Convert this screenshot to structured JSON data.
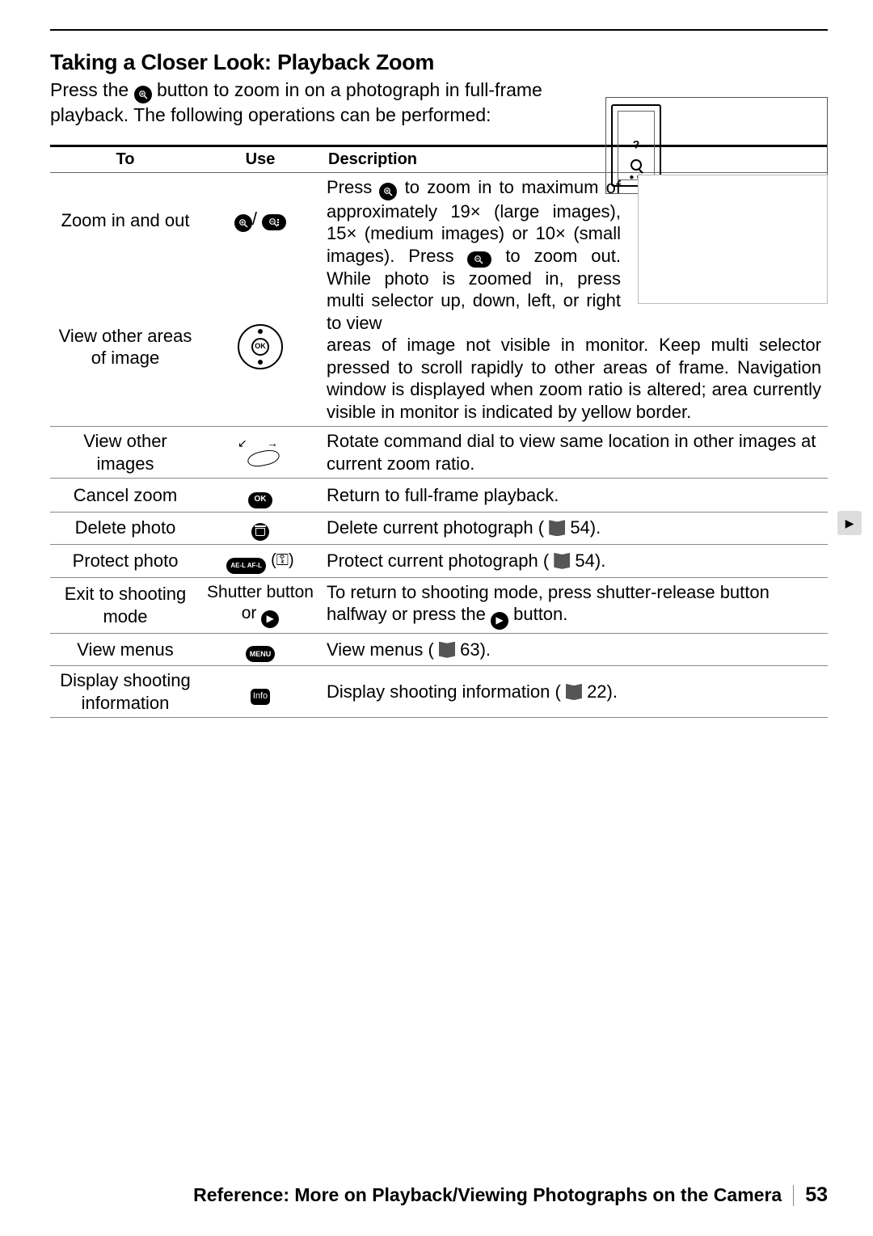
{
  "heading": "Taking a Closer Look: Playback Zoom",
  "intro_a": "Press the ",
  "intro_b": " button to zoom in on a photograph in full-frame playback.  The following operations can be performed:",
  "table": {
    "headers": {
      "to": "To",
      "use": "Use",
      "desc": "Description"
    },
    "row1": {
      "to": "Zoom in and out",
      "desc_a": "Press ",
      "desc_b": " to zoom in to maximum of approximately 19× (large images), 15× (medium images) or 10× (small images).  Press ",
      "desc_c": " to zoom out.  While photo is zoomed in, press multi selector up, down, left, or right to view"
    },
    "row2": {
      "to": "View other areas of image",
      "desc": "areas of image not visible in monitor.  Keep multi selector pressed to scroll rapidly to other areas of frame.  Navigation window is displayed when zoom ratio is altered; area currently visible in monitor is indicated by yellow border."
    },
    "row3": {
      "to": "View other images",
      "desc": "Rotate command dial to view same location in other images at current zoom ratio."
    },
    "row4": {
      "to": "Cancel zoom",
      "use_label": "OK",
      "desc": "Return to full-frame playback."
    },
    "row5": {
      "to": "Delete photo",
      "desc_a": "Delete current photograph (",
      "desc_b": " 54)."
    },
    "row6": {
      "to": "Protect photo",
      "use_a": "AE-L AF-L",
      "desc_a": "Protect current photograph (",
      "desc_b": " 54)."
    },
    "row7": {
      "to": "Exit to shooting mode",
      "use_a": "Shutter button or ",
      "desc_a": "To return to shooting mode, press shutter-release button halfway or press the ",
      "desc_b": " button."
    },
    "row8": {
      "to": "View menus",
      "use_label": "MENU",
      "desc_a": "View menus (",
      "desc_b": " 63)."
    },
    "row9": {
      "to": "Display shooting information",
      "use_label": "Info",
      "desc_a": "Display shooting information (",
      "desc_b": " 22)."
    }
  },
  "footer": {
    "text": "Reference: More on Playback/Viewing Photographs on the Camera",
    "page": "53"
  },
  "side_tab": "▶"
}
